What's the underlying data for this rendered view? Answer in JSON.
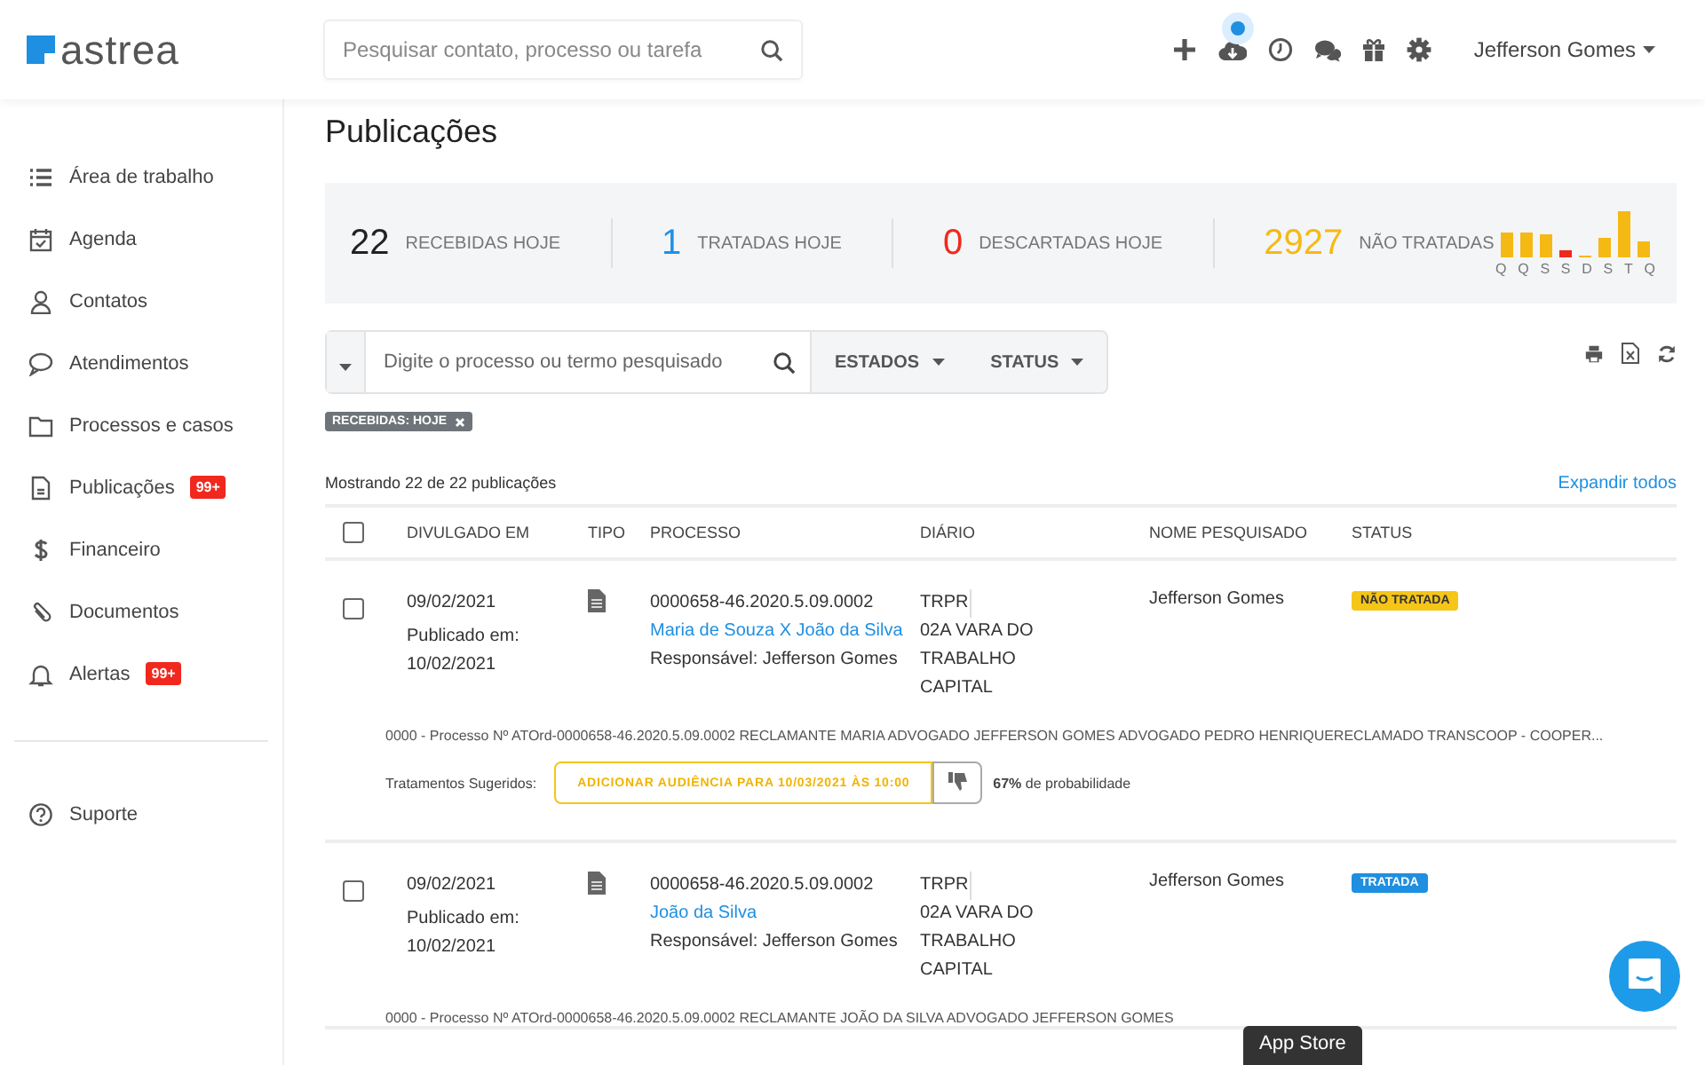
{
  "header": {
    "logo": "astrea",
    "search": {
      "placeholder": "Pesquisar contato, processo ou tarefa"
    },
    "user": "Jefferson Gomes",
    "sync_notification": true
  },
  "sidebar": {
    "items": [
      {
        "label": "Área de trabalho"
      },
      {
        "label": "Agenda"
      },
      {
        "label": "Contatos"
      },
      {
        "label": "Atendimentos"
      },
      {
        "label": "Processos e casos"
      },
      {
        "label": "Publicações",
        "badge": "99+"
      },
      {
        "label": "Financeiro"
      },
      {
        "label": "Documentos"
      },
      {
        "label": "Alertas",
        "badge": "99+"
      }
    ],
    "footer_items": [
      {
        "label": "Suporte"
      }
    ]
  },
  "page": {
    "title": "Publicações"
  },
  "stats": [
    {
      "value": "22",
      "label": "RECEBIDAS HOJE",
      "color": "#222222"
    },
    {
      "value": "1",
      "label": "TRATADAS HOJE",
      "color": "#1e90e6"
    },
    {
      "value": "0",
      "label": "DESCARTADAS HOJE",
      "color": "#f0281e"
    },
    {
      "value": "2927",
      "label": "NÃO TRATADAS",
      "color": "#f5b914"
    }
  ],
  "weekday_labels": [
    "Q",
    "Q",
    "S",
    "S",
    "D",
    "S",
    "T",
    "Q"
  ],
  "filter": {
    "placeholder": "Digite o processo ou termo pesquisado",
    "dropdowns": [
      "ESTADOS",
      "STATUS"
    ]
  },
  "active_filters": [
    "RECEBIDAS: HOJE"
  ],
  "showing": "Mostrando 22 de 22 publicações",
  "expand_all": "Expandir todos",
  "table": {
    "select_all_checked": false,
    "columns": [
      "DIVULGADO EM",
      "TIPO",
      "PROCESSO",
      "DIÁRIO",
      "NOME PESQUISADO",
      "STATUS"
    ],
    "rows": [
      {
        "checked": false,
        "date": "09/02/2021",
        "published_label": "Publicado em:",
        "published_date": "10/02/2021",
        "process": "0000658-46.2020.5.09.0002",
        "parties": "Maria de Souza X João da Silva",
        "responsible": "Responsável: Jefferson Gomes",
        "diario_source": "TRPR",
        "diario_vara": "02A VARA DO TRABALHO CAPITAL",
        "name": "Jefferson Gomes",
        "status": {
          "text": "NÃO TRATADA",
          "kind": "pending"
        },
        "excerpt": "0000 - Processo Nº ATOrd-0000658-46.2020.5.09.0002 RECLAMANTE MARIA ADVOGADO JEFFERSON GOMES ADVOGADO PEDRO HENRIQUERECLAMADO TRANSCOOP - COOPER...",
        "suggestion": {
          "label": "Tratamentos Sugeridos:",
          "action": "ADICIONAR AUDIÊNCIA PARA 10/03/2021 ÀS 10:00",
          "probability": "**67%** de probabilidade"
        }
      },
      {
        "checked": false,
        "date": "09/02/2021",
        "published_label": "Publicado em:",
        "published_date": "10/02/2021",
        "process": "0000658-46.2020.5.09.0002",
        "parties": "João da Silva",
        "responsible": "Responsável: Jefferson Gomes",
        "diario_source": "TRPR",
        "diario_vara": "02A VARA DO TRABALHO CAPITAL",
        "name": "Jefferson Gomes",
        "status": {
          "text": "TRATADA",
          "kind": "done"
        },
        "excerpt": "0000 - Processo Nº ATOrd-0000658-46.2020.5.09.0002 RECLAMANTE JOÃO DA SILVA ADVOGADO JEFFERSON GOMES"
      }
    ]
  },
  "tooltip": "App Store"
}
